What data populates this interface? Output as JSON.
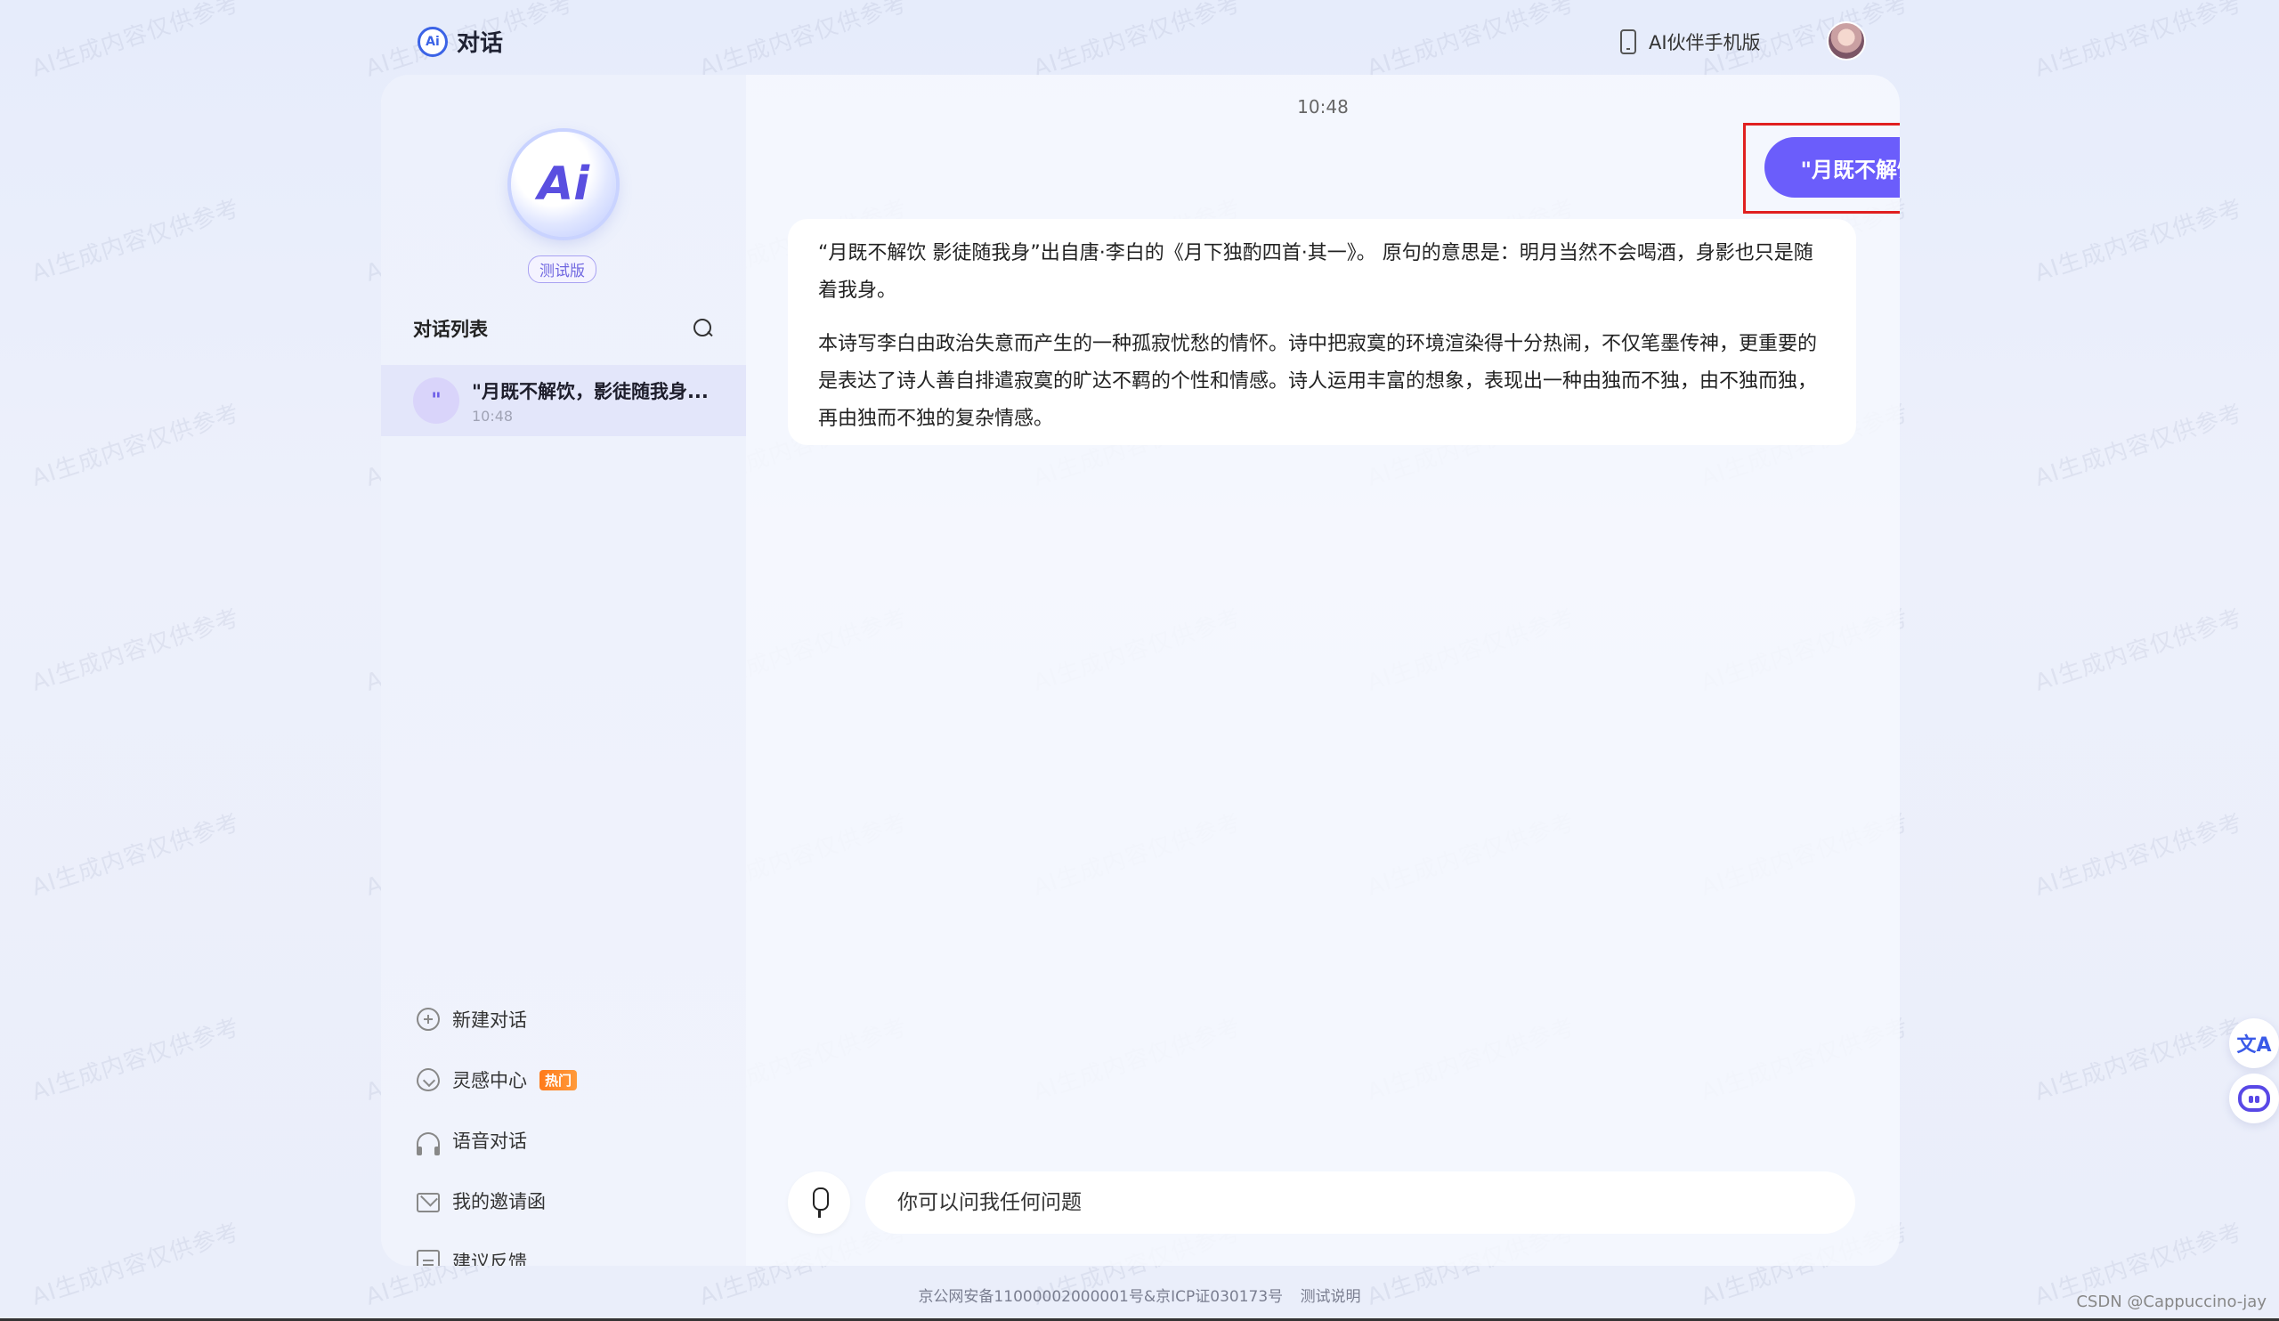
{
  "header": {
    "app_logo_text": "Ai",
    "title": "对话",
    "mobile_link": "AI伙伴手机版"
  },
  "sidebar": {
    "logo_text": "Ai",
    "beta_badge": "测试版",
    "list_title": "对话列表",
    "conversations": [
      {
        "icon": "\"",
        "title": "\"月既不解饮，影徒随我身...",
        "time": "10:48"
      }
    ],
    "menu": [
      {
        "label": "新建对话",
        "icon": "plus-circle-icon"
      },
      {
        "label": "灵感中心",
        "icon": "bulb-icon",
        "badge": "热门"
      },
      {
        "label": "语音对话",
        "icon": "headset-icon"
      },
      {
        "label": "我的邀请函",
        "icon": "mail-icon"
      },
      {
        "label": "建议反馈",
        "icon": "edit-icon"
      }
    ]
  },
  "chat": {
    "timestamp": "10:48",
    "user_message": "\"月既不解饮，影徒随我身。\"是什么意思",
    "ai_paragraphs": [
      "“月既不解饮 影徒随我身”出自唐·李白的《月下独酌四首·其一》。 原句的意思是：明月当然不会喝酒，身影也只是随着我身。",
      "本诗写李白由政治失意而产生的一种孤寂忧愁的情怀。诗中把寂寞的环境渲染得十分热闹，不仅笔墨传神，更重要的是表达了诗人善自排遣寂寞的旷达不羁的个性和情感。诗人运用丰富的想象，表现出一种由独而不独，由不独而独，再由独而不独的复杂情感。"
    ],
    "input_placeholder": "你可以问我任何问题"
  },
  "floating": {
    "translate_glyph": "文A"
  },
  "watermark_text": "AI生成内容仅供参考",
  "footer": {
    "icp": "京公网安备11000002000001号&京ICP证030173号",
    "test_note": "测试说明",
    "credit": "CSDN @Cappuccino-jay"
  },
  "colors": {
    "accent": "#6b5dfb",
    "highlight_border": "#e02020",
    "hot_badge": "#ff7a1a"
  }
}
